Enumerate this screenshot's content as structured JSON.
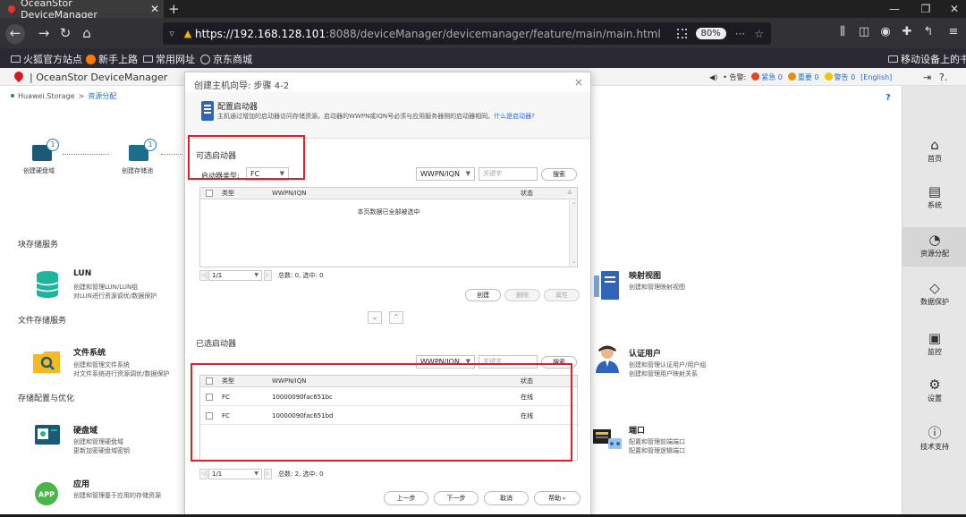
{
  "browser": {
    "tab_title": "OceanStor DeviceManager",
    "tab_close": "✕",
    "new_tab": "+",
    "window_controls": [
      "—",
      "❐",
      "✕"
    ],
    "url_host": "https://192.168.128.101",
    "url_rest": ":8088/deviceManager/devicemanager/feature/main/main.html",
    "zoom": "80%",
    "more": "···",
    "star": "☆",
    "bookmarks": [
      "火狐官方站点",
      "新手上路",
      "常用网址",
      "京东商城"
    ],
    "mobile_bookmarks": "移动设备上的书签"
  },
  "app": {
    "title": "OceanStor DeviceManager",
    "alarms": {
      "label": "• 告警:",
      "critical": "紧急 0",
      "major": "重要 0",
      "warning": "警告 0",
      "language": "[English]"
    },
    "breadcrumb": {
      "root": "Huawei.Storage",
      "separator": ">",
      "current": "资源分配"
    },
    "help": "?"
  },
  "flow": {
    "step1_label": "创建硬盘域",
    "step1_num": "1",
    "step2_label": "创建存储池",
    "step2_num": "1"
  },
  "sections": {
    "block": "块存储服务",
    "file": "文件存储服务",
    "config": "存储配置与优化"
  },
  "services": {
    "lun": {
      "name": "LUN",
      "desc1": "创建和管理LUN/LUN组",
      "desc2": "对LUN进行资源调优/数据保护"
    },
    "fs": {
      "name": "文件系统",
      "desc1": "创建和管理文件系统",
      "desc2": "对文件系统进行资源调优/数据保护"
    },
    "disk_domain": {
      "name": "硬盘域",
      "desc1": "创建和管理硬盘域",
      "desc2": "更新加密硬盘域密钥"
    },
    "app": {
      "name": "应用",
      "desc1": "创建和管理基于应用的存储资源",
      "icon_text": "APP"
    },
    "mapping": {
      "name": "映射视图",
      "desc1": "创建和管理映射视图"
    },
    "auth_user": {
      "name": "认证用户",
      "desc1": "创建和管理认证用户/用户组",
      "desc2": "创建和管理用户映射关系"
    },
    "port": {
      "name": "端口",
      "desc1": "配置和管理前端端口",
      "desc2": "配置和管理逻辑端口"
    }
  },
  "sidebar": {
    "items": [
      {
        "label": "首页",
        "icon": "home-icon"
      },
      {
        "label": "系统",
        "icon": "system-icon"
      },
      {
        "label": "资源分配",
        "icon": "provisioning-icon"
      },
      {
        "label": "数据保护",
        "icon": "shield-icon"
      },
      {
        "label": "监控",
        "icon": "monitor-icon"
      },
      {
        "label": "设置",
        "icon": "gear-icon"
      },
      {
        "label": "技术支持",
        "icon": "help-icon"
      }
    ]
  },
  "dialog": {
    "title": "创建主机向导: 步骤 4-2",
    "close": "×",
    "header_title": "配置启动器",
    "header_desc": "主机通过增加的启动器访问存储资源。启动器的WWPN或IQN号必须与应用服务器侧的启动器相同。",
    "header_link": "什么是启动器?",
    "available": {
      "section": "可选启动器",
      "type_label": "启动器类型:",
      "type_value": "FC",
      "search_field": "WWPN/IQN",
      "search_placeholder": "关键字",
      "search_button": "搜索",
      "columns": [
        "类型",
        "WWPN/IQN",
        "状态"
      ],
      "empty_text": "本页数据已全部被选中",
      "page_value": "1/1",
      "summary": "总数: 0, 选中: 0",
      "actions": [
        "创建",
        "删除",
        "属性"
      ]
    },
    "selected": {
      "section": "已选启动器",
      "search_field": "WWPN/IQN",
      "search_placeholder": "关键字",
      "search_button": "搜索",
      "columns": [
        "类型",
        "WWPN/IQN",
        "状态"
      ],
      "rows": [
        {
          "type": "FC",
          "wwpn": "10000090fac651bc",
          "status": "在线"
        },
        {
          "type": "FC",
          "wwpn": "10000090fac651bd",
          "status": "在线"
        }
      ],
      "page_value": "1/1",
      "summary": "总数: 2, 选中: 0"
    },
    "footer": {
      "prev": "上一步",
      "next": "下一步",
      "cancel": "取消",
      "help": "帮助"
    }
  },
  "colors": {
    "highlight": "#e31e24",
    "link": "#1e6cd6",
    "teal": "#1a5a74",
    "critical": "#e8421c",
    "major": "#f08c00",
    "warning": "#f5c400"
  }
}
